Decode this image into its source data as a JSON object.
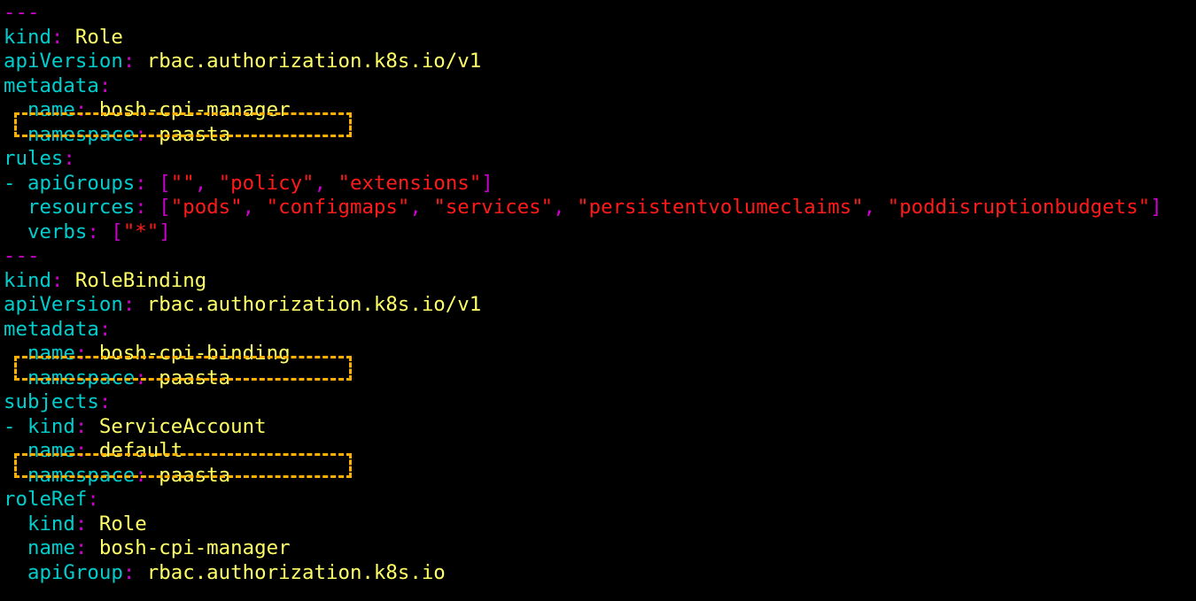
{
  "lines": [
    {
      "type": "sep",
      "text": "---"
    },
    {
      "type": "kv",
      "indent": "",
      "key": "kind",
      "value": "Role"
    },
    {
      "type": "kv",
      "indent": "",
      "key": "apiVersion",
      "value": "rbac.authorization.k8s.io/v1"
    },
    {
      "type": "kv",
      "indent": "",
      "key": "metadata",
      "value": ""
    },
    {
      "type": "kv",
      "indent": "  ",
      "key": "name",
      "value": "bosh-cpi-manager"
    },
    {
      "type": "kv",
      "indent": "  ",
      "key": "namespace",
      "value": "paasta"
    },
    {
      "type": "kv",
      "indent": "",
      "key": "rules",
      "value": ""
    },
    {
      "type": "list",
      "indent": "- ",
      "key": "apiGroups",
      "items": [
        "\"\"",
        "\"policy\"",
        "\"extensions\""
      ]
    },
    {
      "type": "list",
      "indent": "  ",
      "key": "resources",
      "items": [
        "\"pods\"",
        "\"configmaps\"",
        "\"services\"",
        "\"persistentvolumeclaims\"",
        "\"poddisruptionbudgets\""
      ]
    },
    {
      "type": "list",
      "indent": "  ",
      "key": "verbs",
      "items": [
        "\"*\""
      ]
    },
    {
      "type": "sep",
      "text": "---"
    },
    {
      "type": "kv",
      "indent": "",
      "key": "kind",
      "value": "RoleBinding"
    },
    {
      "type": "kv",
      "indent": "",
      "key": "apiVersion",
      "value": "rbac.authorization.k8s.io/v1"
    },
    {
      "type": "kv",
      "indent": "",
      "key": "metadata",
      "value": ""
    },
    {
      "type": "kv",
      "indent": "  ",
      "key": "name",
      "value": "bosh-cpi-binding"
    },
    {
      "type": "kv",
      "indent": "  ",
      "key": "namespace",
      "value": "paasta"
    },
    {
      "type": "kv",
      "indent": "",
      "key": "subjects",
      "value": ""
    },
    {
      "type": "kv",
      "indent": "- ",
      "key": "kind",
      "value": "ServiceAccount"
    },
    {
      "type": "kv",
      "indent": "  ",
      "key": "name",
      "value": "default"
    },
    {
      "type": "kv",
      "indent": "  ",
      "key": "namespace",
      "value": "paasta"
    },
    {
      "type": "kv",
      "indent": "",
      "key": "roleRef",
      "value": ""
    },
    {
      "type": "kv",
      "indent": "  ",
      "key": "kind",
      "value": "Role"
    },
    {
      "type": "kv",
      "indent": "  ",
      "key": "name",
      "value": "bosh-cpi-manager"
    },
    {
      "type": "kv",
      "indent": "  ",
      "key": "apiGroup",
      "value": "rbac.authorization.k8s.io"
    }
  ],
  "punct": {
    "colon": ":",
    "comma": ", ",
    "open_bracket": "[",
    "close_bracket": "]"
  },
  "highlighted_lines": [
    5,
    15,
    19
  ],
  "colors": {
    "background": "#000000",
    "key": "#00CDCD",
    "punctuation": "#CD00CD",
    "scalar_value": "#FFFF66",
    "string": "#FF1A1A",
    "highlight_box": "#FFB000"
  }
}
